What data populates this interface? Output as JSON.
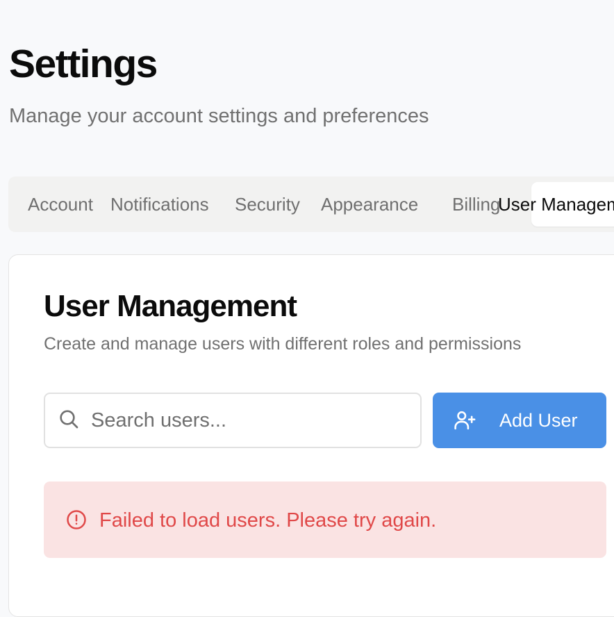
{
  "header": {
    "title": "Settings",
    "subtitle": "Manage your account settings and preferences"
  },
  "tabs": [
    {
      "label": "Account",
      "active": false
    },
    {
      "label": "Notifications",
      "active": false
    },
    {
      "label": "Security",
      "active": false
    },
    {
      "label": "Appearance",
      "active": false
    },
    {
      "label": "Billing",
      "active": false
    },
    {
      "label": "User Management",
      "active": true
    }
  ],
  "user_management": {
    "title": "User Management",
    "description": "Create and manage users with different roles and permissions",
    "search": {
      "placeholder": "Search users...",
      "value": "",
      "icon": "search-icon"
    },
    "add_button": {
      "label": "Add User",
      "icon": "user-plus-icon"
    },
    "error": {
      "message": "Failed to load users. Please try again.",
      "icon": "alert-circle-icon"
    }
  },
  "colors": {
    "accent": "#4a90e6",
    "error_text": "#e04848",
    "error_bg": "#fae3e3",
    "page_bg": "#f8f9fb"
  }
}
